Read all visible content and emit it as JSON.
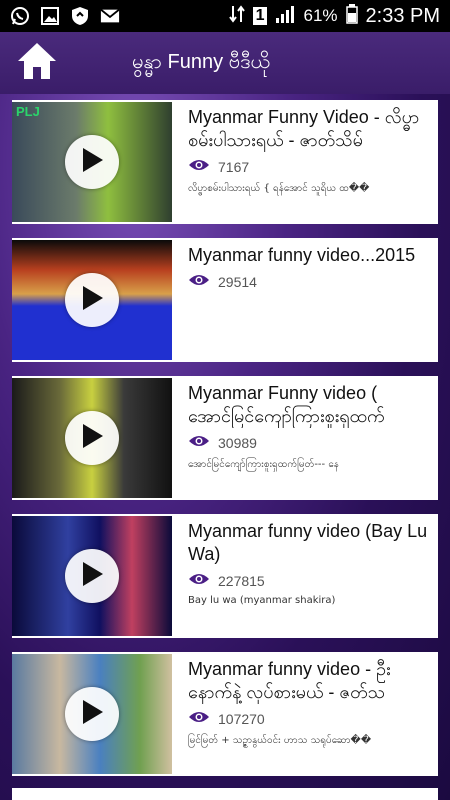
{
  "status_bar": {
    "battery_percent": "61%",
    "time": "2:33 PM",
    "sim_label": "1",
    "icons": [
      "whatsapp-icon",
      "image-icon",
      "shield-icon",
      "gmail-icon",
      "data-arrows-icon",
      "signal-icon",
      "battery-icon"
    ]
  },
  "header": {
    "title": "မွန္မာ Funny ဗီဒီယို",
    "home_icon": "home-icon"
  },
  "videos": [
    {
      "title": "Myanmar Funny Video - လိပ္ဓာစမ်းပါသားရယ် - ဇာတ်သိမ်",
      "views": "7167",
      "description": "လိပ္ဓာစမ်းပါသားရယ် { ရန်အောင် သူရိယ ထ��",
      "thumb_tag": "PLJ"
    },
    {
      "title": "Myanmar funny video...2015",
      "views": "29514",
      "description": ""
    },
    {
      "title": "Myanmar Funny video ( အောင်မြင်ကျော်ကြားစူးရှထက်",
      "views": "30989",
      "description": "အောင်မြင်ကျော်ကြားစူးရှထက်မြတ်--- နေ"
    },
    {
      "title": "Myanmar funny video (Bay Lu Wa)",
      "views": "227815",
      "description": "Bay lu wa (myanmar shakira)"
    },
    {
      "title": "Myanmar funny video - ဦးနောက်နဲ့ လုပ်စားမယ် - ဇတ်သ",
      "views": "107270",
      "description": "မြင်မြတ် + သဉ္ဇာနွယ်ဝင်း ဟာသ သရုပ်ဆော��"
    }
  ],
  "colors": {
    "accent": "#4b1f86",
    "eye": "#4b1f86",
    "header_bg": "#3f2170"
  }
}
